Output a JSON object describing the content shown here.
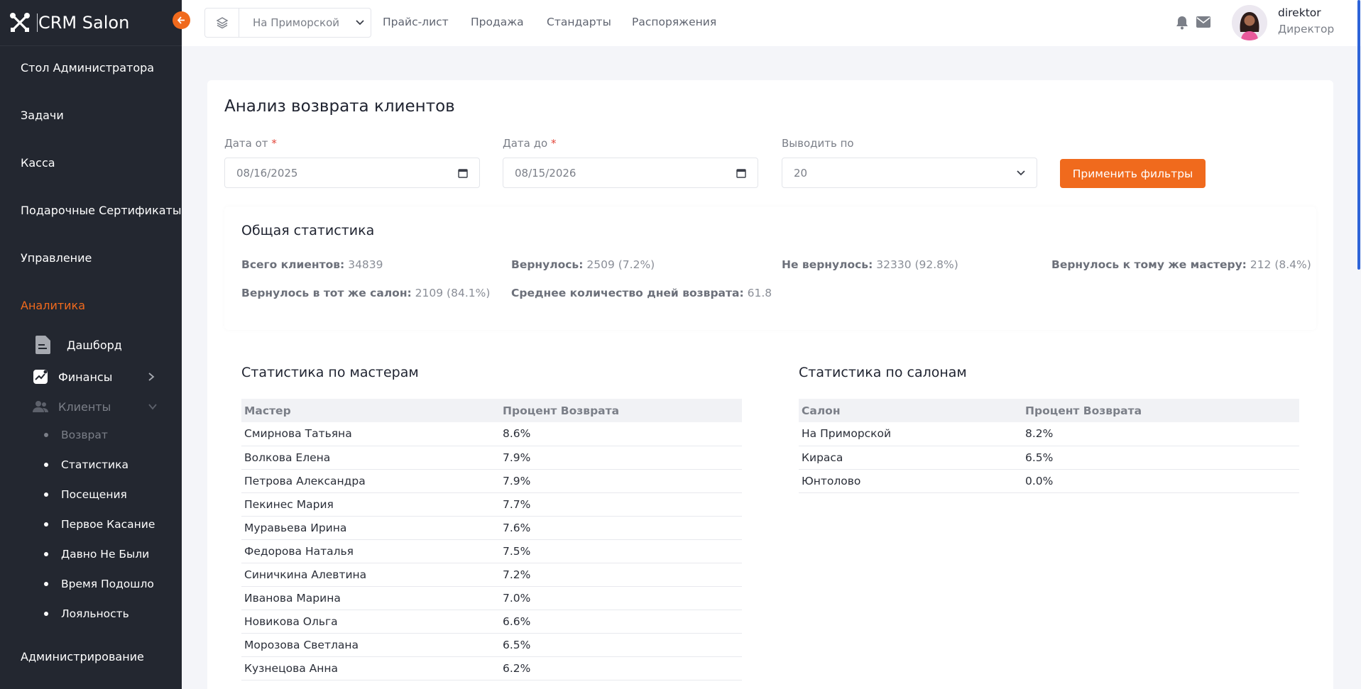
{
  "app": {
    "title": "CRM Salon"
  },
  "sidebar": {
    "items": [
      "Стол Администратора",
      "Задачи",
      "Касса",
      "Подарочные Сертификаты",
      "Управление",
      "Аналитика"
    ],
    "analytics_sub": {
      "dashboard": "Дашборд",
      "finance": "Финансы",
      "clients": "Клиенты"
    },
    "clients_sub": [
      "Возврат",
      "Статистика",
      "Посещения",
      "Первое Касание",
      "Давно Не Были",
      "Время Подошло",
      "Лояльность"
    ],
    "admin": "Администрирование"
  },
  "topbar": {
    "salon": "На Приморской",
    "nav": [
      "Прайс-лист",
      "Продажа",
      "Стандарты",
      "Распоряжения"
    ],
    "user_name": "direktor",
    "user_role": "Директор"
  },
  "page": {
    "title": "Анализ возврата клиентов",
    "filters": {
      "date_from_label": "Дата от",
      "date_from": "08/16/2025",
      "date_to_label": "Дата до",
      "date_to": "08/15/2026",
      "page_size_label": "Выводить по",
      "page_size": "20",
      "apply": "Применить фильтры"
    },
    "summary": {
      "title": "Общая статистика",
      "total_label": "Всего клиентов:",
      "total": "34839",
      "returned_label": "Вернулось:",
      "returned": "2509 (7.2%)",
      "not_returned_label": "Не вернулось:",
      "not_returned": "32330 (92.8%)",
      "same_master_label": "Вернулось к тому же мастеру:",
      "same_master": "212 (8.4%)",
      "same_salon_label": "Вернулось в тот же салон:",
      "same_salon": "2109 (84.1%)",
      "avg_days_label": "Среднее количество дней возврата:",
      "avg_days": "61.8"
    },
    "masters": {
      "title": "Статистика по мастерам",
      "headers": [
        "Мастер",
        "Процент Возврата"
      ],
      "rows": [
        [
          "Смирнова Татьяна",
          "8.6%"
        ],
        [
          "Волкова Елена",
          "7.9%"
        ],
        [
          "Петрова Александра",
          "7.9%"
        ],
        [
          "Пекинес Мария",
          "7.7%"
        ],
        [
          "Муравьева Ирина",
          "7.6%"
        ],
        [
          "Федорова Наталья",
          "7.5%"
        ],
        [
          "Синичкина Алевтина",
          "7.2%"
        ],
        [
          "Иванова Марина",
          "7.0%"
        ],
        [
          "Новикова Ольга",
          "6.6%"
        ],
        [
          "Морозова Светлана",
          "6.5%"
        ],
        [
          "Кузнецова Анна",
          "6.2%"
        ]
      ]
    },
    "salons": {
      "title": "Статистика по салонам",
      "headers": [
        "Салон",
        "Процент Возврата"
      ],
      "rows": [
        [
          "На Приморской",
          "8.2%"
        ],
        [
          "Кираса",
          "6.5%"
        ],
        [
          "Юнтолово",
          "0.0%"
        ]
      ]
    }
  },
  "colors": {
    "accent": "#f06a1d",
    "sidebar": "#232730",
    "muted": "#7b7f88"
  }
}
